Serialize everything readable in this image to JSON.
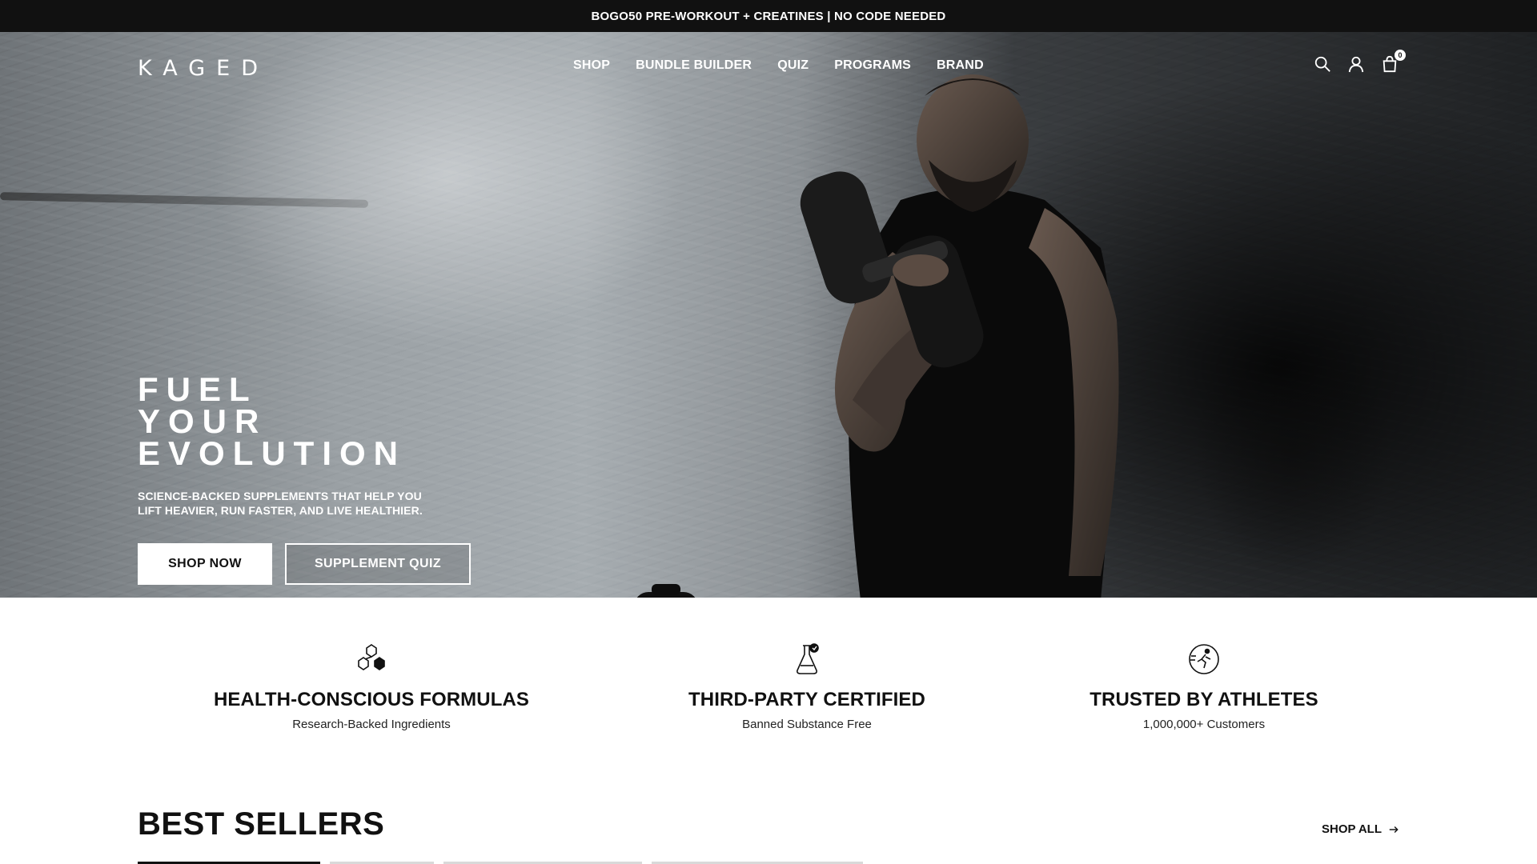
{
  "promo_bar": {
    "text": "BOGO50 PRE-WORKOUT + CREATINES | NO CODE NEEDED"
  },
  "header": {
    "logo": "KAGED",
    "nav": [
      "SHOP",
      "BUNDLE BUILDER",
      "QUIZ",
      "PROGRAMS",
      "BRAND"
    ],
    "icons": {
      "search": "search-icon",
      "account": "user-icon",
      "cart": "shopping-bag-icon"
    },
    "cart_count": "0"
  },
  "hero": {
    "title_lines": [
      "FUEL",
      "YOUR",
      "EVOLUTION"
    ],
    "subtitle_line1": "SCIENCE-BACKED SUPPLEMENTS THAT HELP YOU",
    "subtitle_line2": "LIFT HEAVIER, RUN FASTER, AND LIVE HEALTHIER.",
    "primary_button": "SHOP NOW",
    "secondary_button": "SUPPLEMENT QUIZ"
  },
  "features": [
    {
      "icon": "molecule-icon",
      "title": "HEALTH-CONSCIOUS FORMULAS",
      "subtitle": "Research-Backed Ingredients"
    },
    {
      "icon": "flask-check-icon",
      "title": "THIRD-PARTY CERTIFIED",
      "subtitle": "Banned Substance Free"
    },
    {
      "icon": "runner-icon",
      "title": "TRUSTED BY ATHLETES",
      "subtitle": "1,000,000+ Customers"
    }
  ],
  "best_sellers": {
    "title": "BEST SELLERS",
    "shop_all": "SHOP ALL"
  },
  "colors": {
    "promo_bg": "#111111",
    "text_dark": "#111111",
    "hero_accent": "#ffffff"
  }
}
